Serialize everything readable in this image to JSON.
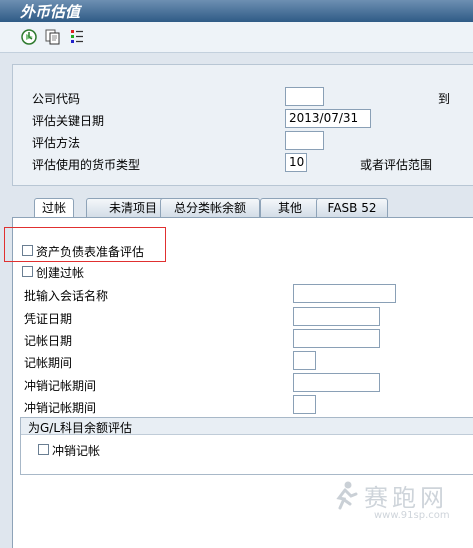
{
  "window": {
    "title": "外币估值"
  },
  "toolbar": {
    "buttons": [
      {
        "icon": "execute-clock-icon"
      },
      {
        "icon": "copy-pages-icon"
      },
      {
        "icon": "selection-options-icon"
      }
    ]
  },
  "criteria": {
    "company_code": {
      "label": "公司代码",
      "value": "",
      "to_label": "到",
      "to_value": ""
    },
    "key_date": {
      "label": "评估关键日期",
      "value": "2013/07/31"
    },
    "method": {
      "label": "评估方法",
      "value": ""
    },
    "currency_type": {
      "label": "评估使用的货币类型",
      "value": "10",
      "or_label": "或者评估范围"
    }
  },
  "tabs": [
    {
      "label": "过帐",
      "active": true
    },
    {
      "label": "未清项目",
      "active": false
    },
    {
      "label": "总分类帐余额",
      "active": false
    },
    {
      "label": "其他",
      "active": false
    },
    {
      "label": "FASB 52",
      "active": false
    }
  ],
  "posting": {
    "balance_sheet_prep": {
      "label": "资产负债表准备评估",
      "checked": false
    },
    "create_posting": {
      "label": "创建过帐",
      "checked": false
    },
    "batch_session_name": {
      "label": "批输入会话名称",
      "value": ""
    },
    "document_date": {
      "label": "凭证日期",
      "value": ""
    },
    "posting_date": {
      "label": "记帐日期",
      "value": ""
    },
    "posting_period": {
      "label": "记帐期间",
      "value": ""
    },
    "reversal_posting_date": {
      "label": "冲销记帐期间",
      "value": ""
    },
    "reversal_posting_period": {
      "label": "冲销记帐期间",
      "value": ""
    }
  },
  "gl_group": {
    "title": "为G/L科目余额评估",
    "reversal_posting": {
      "label": "冲销记帐",
      "checked": false
    }
  },
  "watermark": {
    "text": "赛跑网",
    "url": "www.91sp.com"
  }
}
